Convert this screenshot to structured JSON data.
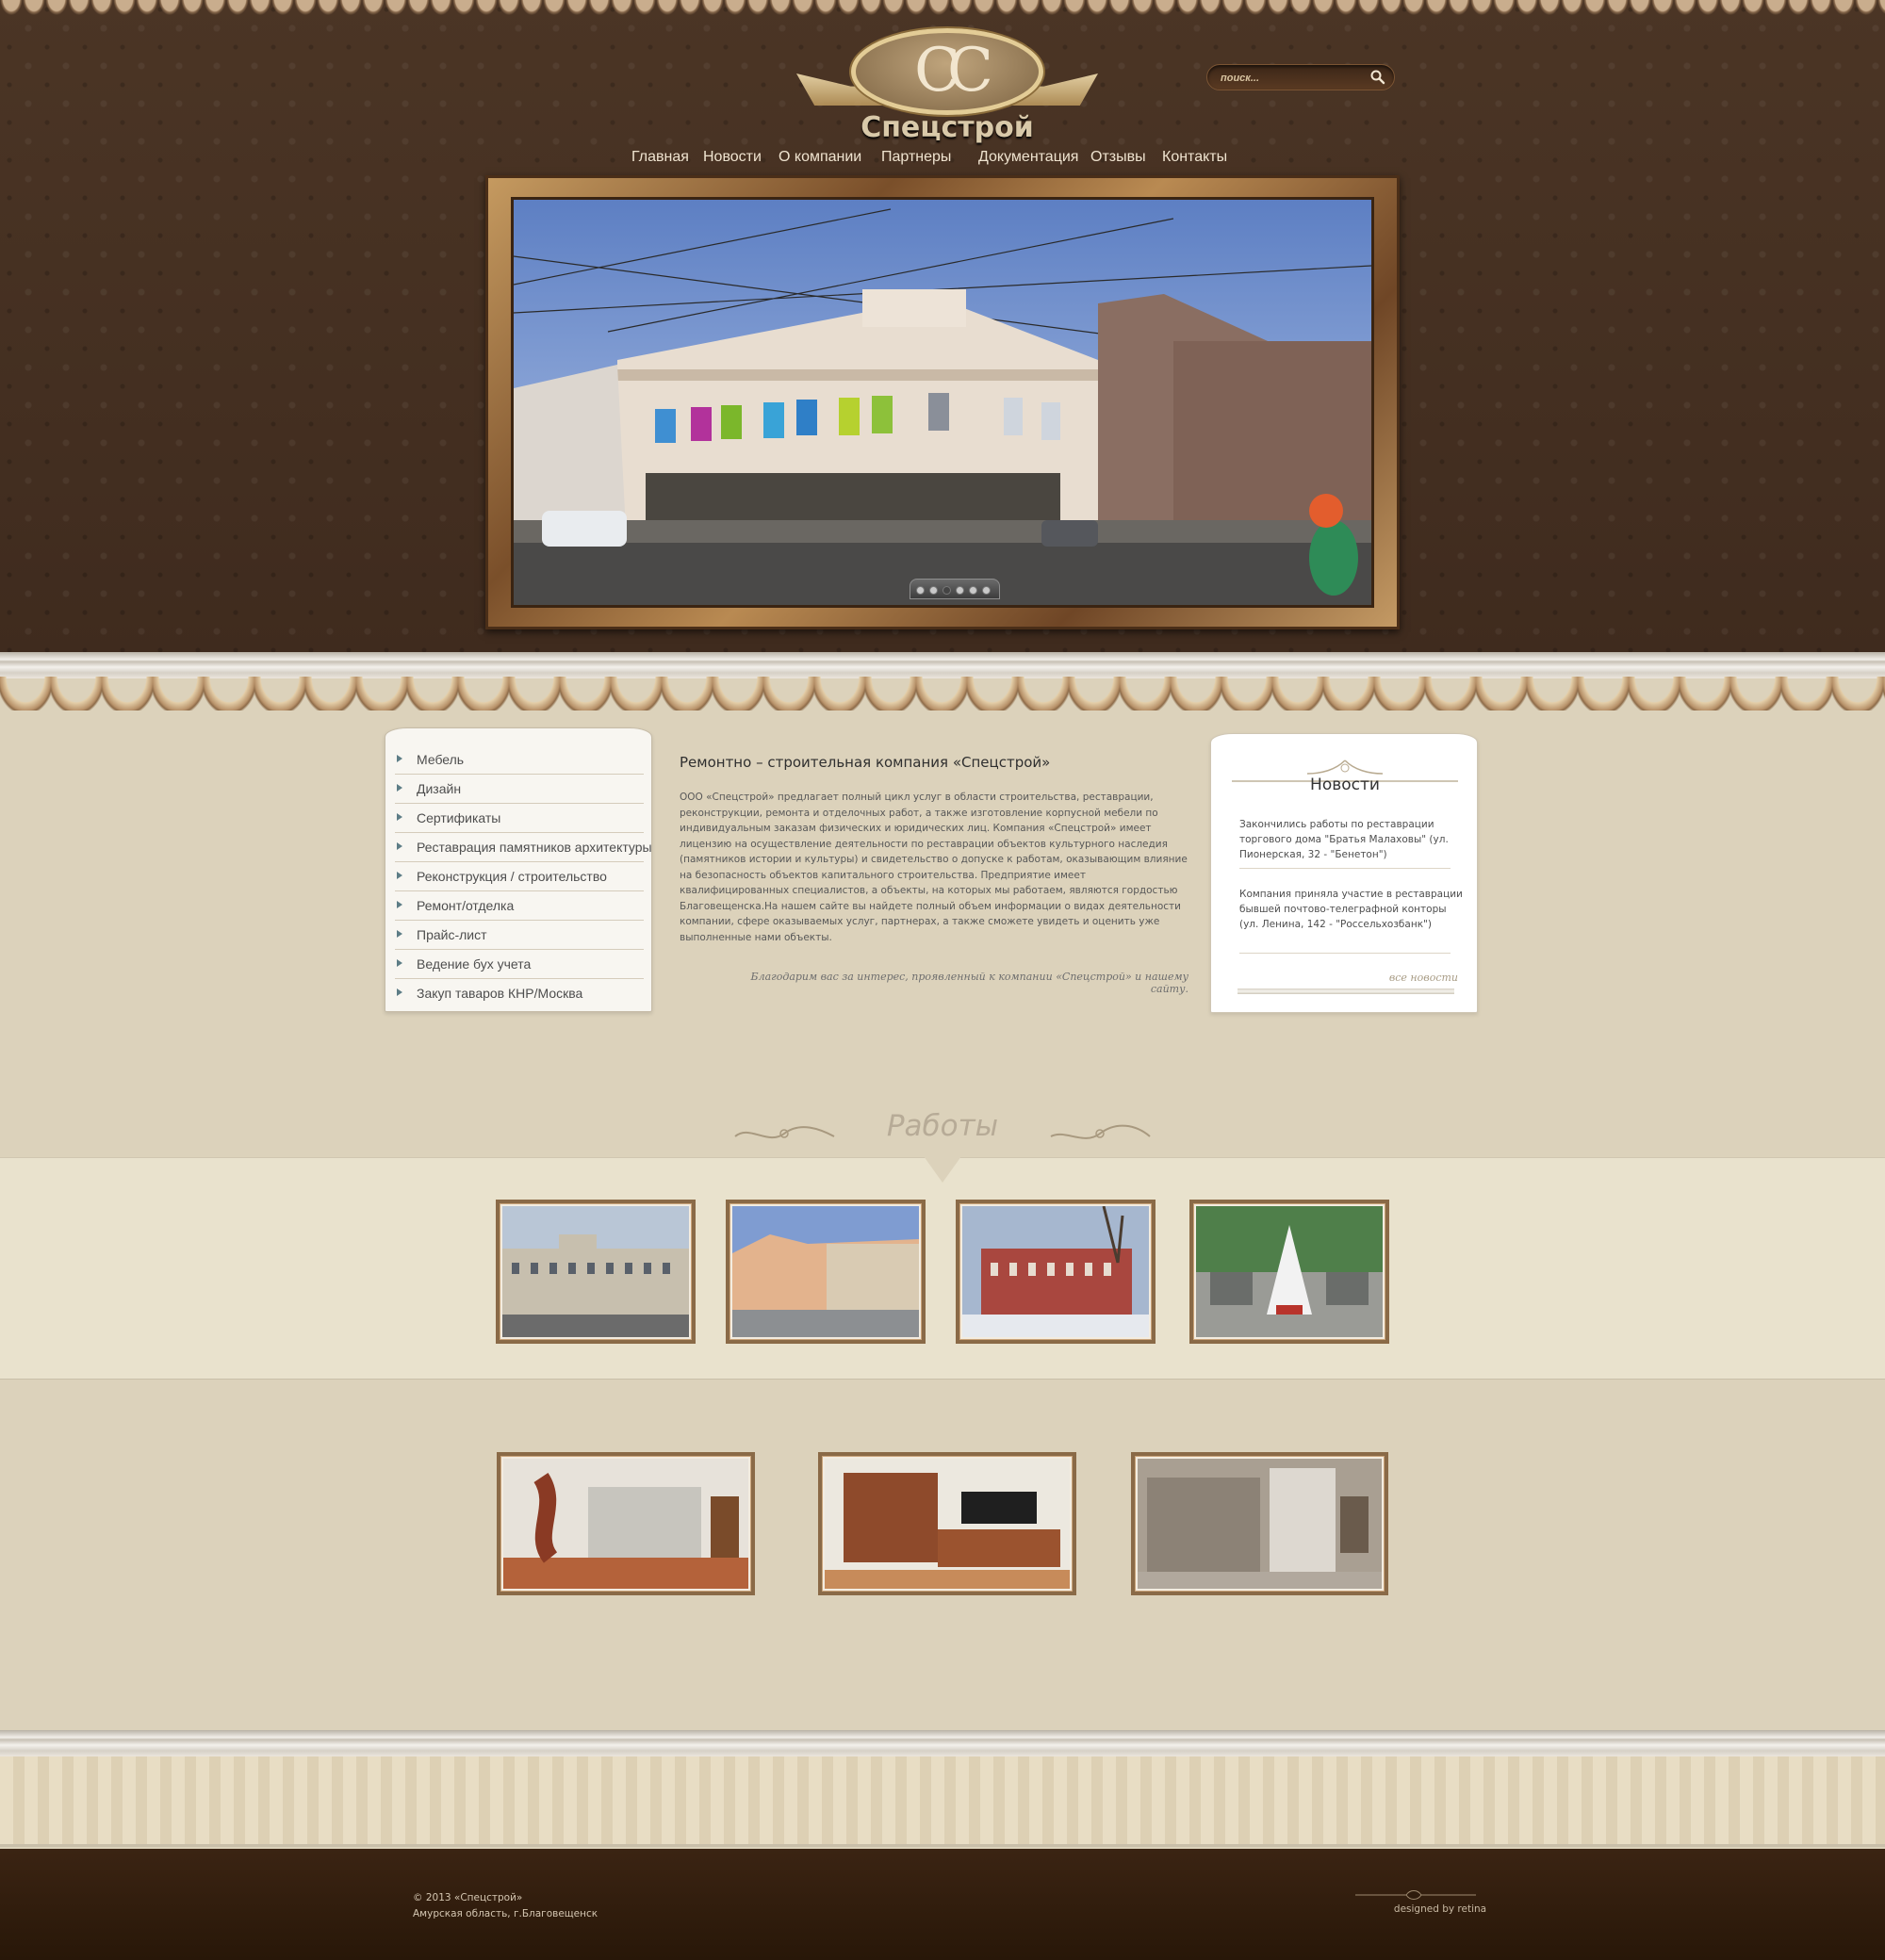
{
  "brand": {
    "mark": "CC",
    "name": "Спецстрой"
  },
  "search": {
    "placeholder": "поиск..."
  },
  "nav": [
    {
      "label": "Главная"
    },
    {
      "label": "Новости"
    },
    {
      "label": "О компании"
    },
    {
      "label": "Партнеры"
    },
    {
      "label": "Документация"
    },
    {
      "label": "Отзывы"
    },
    {
      "label": "Контакты"
    }
  ],
  "slider": {
    "slide_count": 6,
    "active_slide": 3
  },
  "sidebar": {
    "items": [
      {
        "label": "Мебель"
      },
      {
        "label": "Дизайн"
      },
      {
        "label": "Сертификаты"
      },
      {
        "label": "Реставрация памятников архитектуры"
      },
      {
        "label": "Реконструкция / строительство"
      },
      {
        "label": "Ремонт/отделка"
      },
      {
        "label": "Прайс-лист"
      },
      {
        "label": "Ведение бух учета"
      },
      {
        "label": "Закуп таваров КНР/Москва"
      }
    ]
  },
  "article": {
    "title": "Ремонтно – строительная компания «Спецстрой»",
    "body": "ООО «Спецстрой» предлагает полный цикл услуг в области строительства, реставрации, реконструкции, ремонта и отделочных работ, а также изготовление корпусной мебели по индивидуальным заказам физических и юридических лиц. Компания «Спецстрой» имеет лицензию на осуществление деятельности по реставрации объектов культурного наследия (памятников истории и культуры) и свидетельство о допуске к работам, оказывающим влияние на безопасность объектов капитального строительства. Предприятие имеет квалифицированных специалистов, а объекты, на которых мы работаем, являются гордостью Благовещенска.На нашем сайте вы найдете полный объем информации о видах деятельности компании, сфере оказываемых услуг, партнерах, а также сможете увидеть и оценить уже выполненные нами объекты.",
    "thanks": "Благодарим вас за интерес, проявленный к компании «Спецстрой» и нашему сайту."
  },
  "news": {
    "title": "Новости",
    "items": [
      {
        "text": "Закончились работы по реставрации торгового дома \"Братья Малаховы\" (ул. Пионерская, 32 - \"Бенетон\")"
      },
      {
        "text": "Компания приняла участие в реставрации бывшей почтово-телеграфной конторы (ул. Ленина, 142 - \"Россельхозбанк\")"
      }
    ],
    "all_link": "все новости"
  },
  "works": {
    "title": "Работы"
  },
  "footer": {
    "copyright": "© 2013 «Спецстрой»",
    "address": "Амурская область, г.Благовещенск",
    "designed": "designed by retina"
  },
  "colors": {
    "header_brown": "#45301f",
    "page_beige": "#dcd2bb",
    "frame_gold": "#b98a52",
    "menu_arrow": "#5d7d86",
    "footer_dark": "#2e1b0c"
  },
  "icons": [
    "search-icon",
    "menu-arrow-icon",
    "news-ornament-icon",
    "works-swirl-icon",
    "footer-ornament-icon"
  ]
}
